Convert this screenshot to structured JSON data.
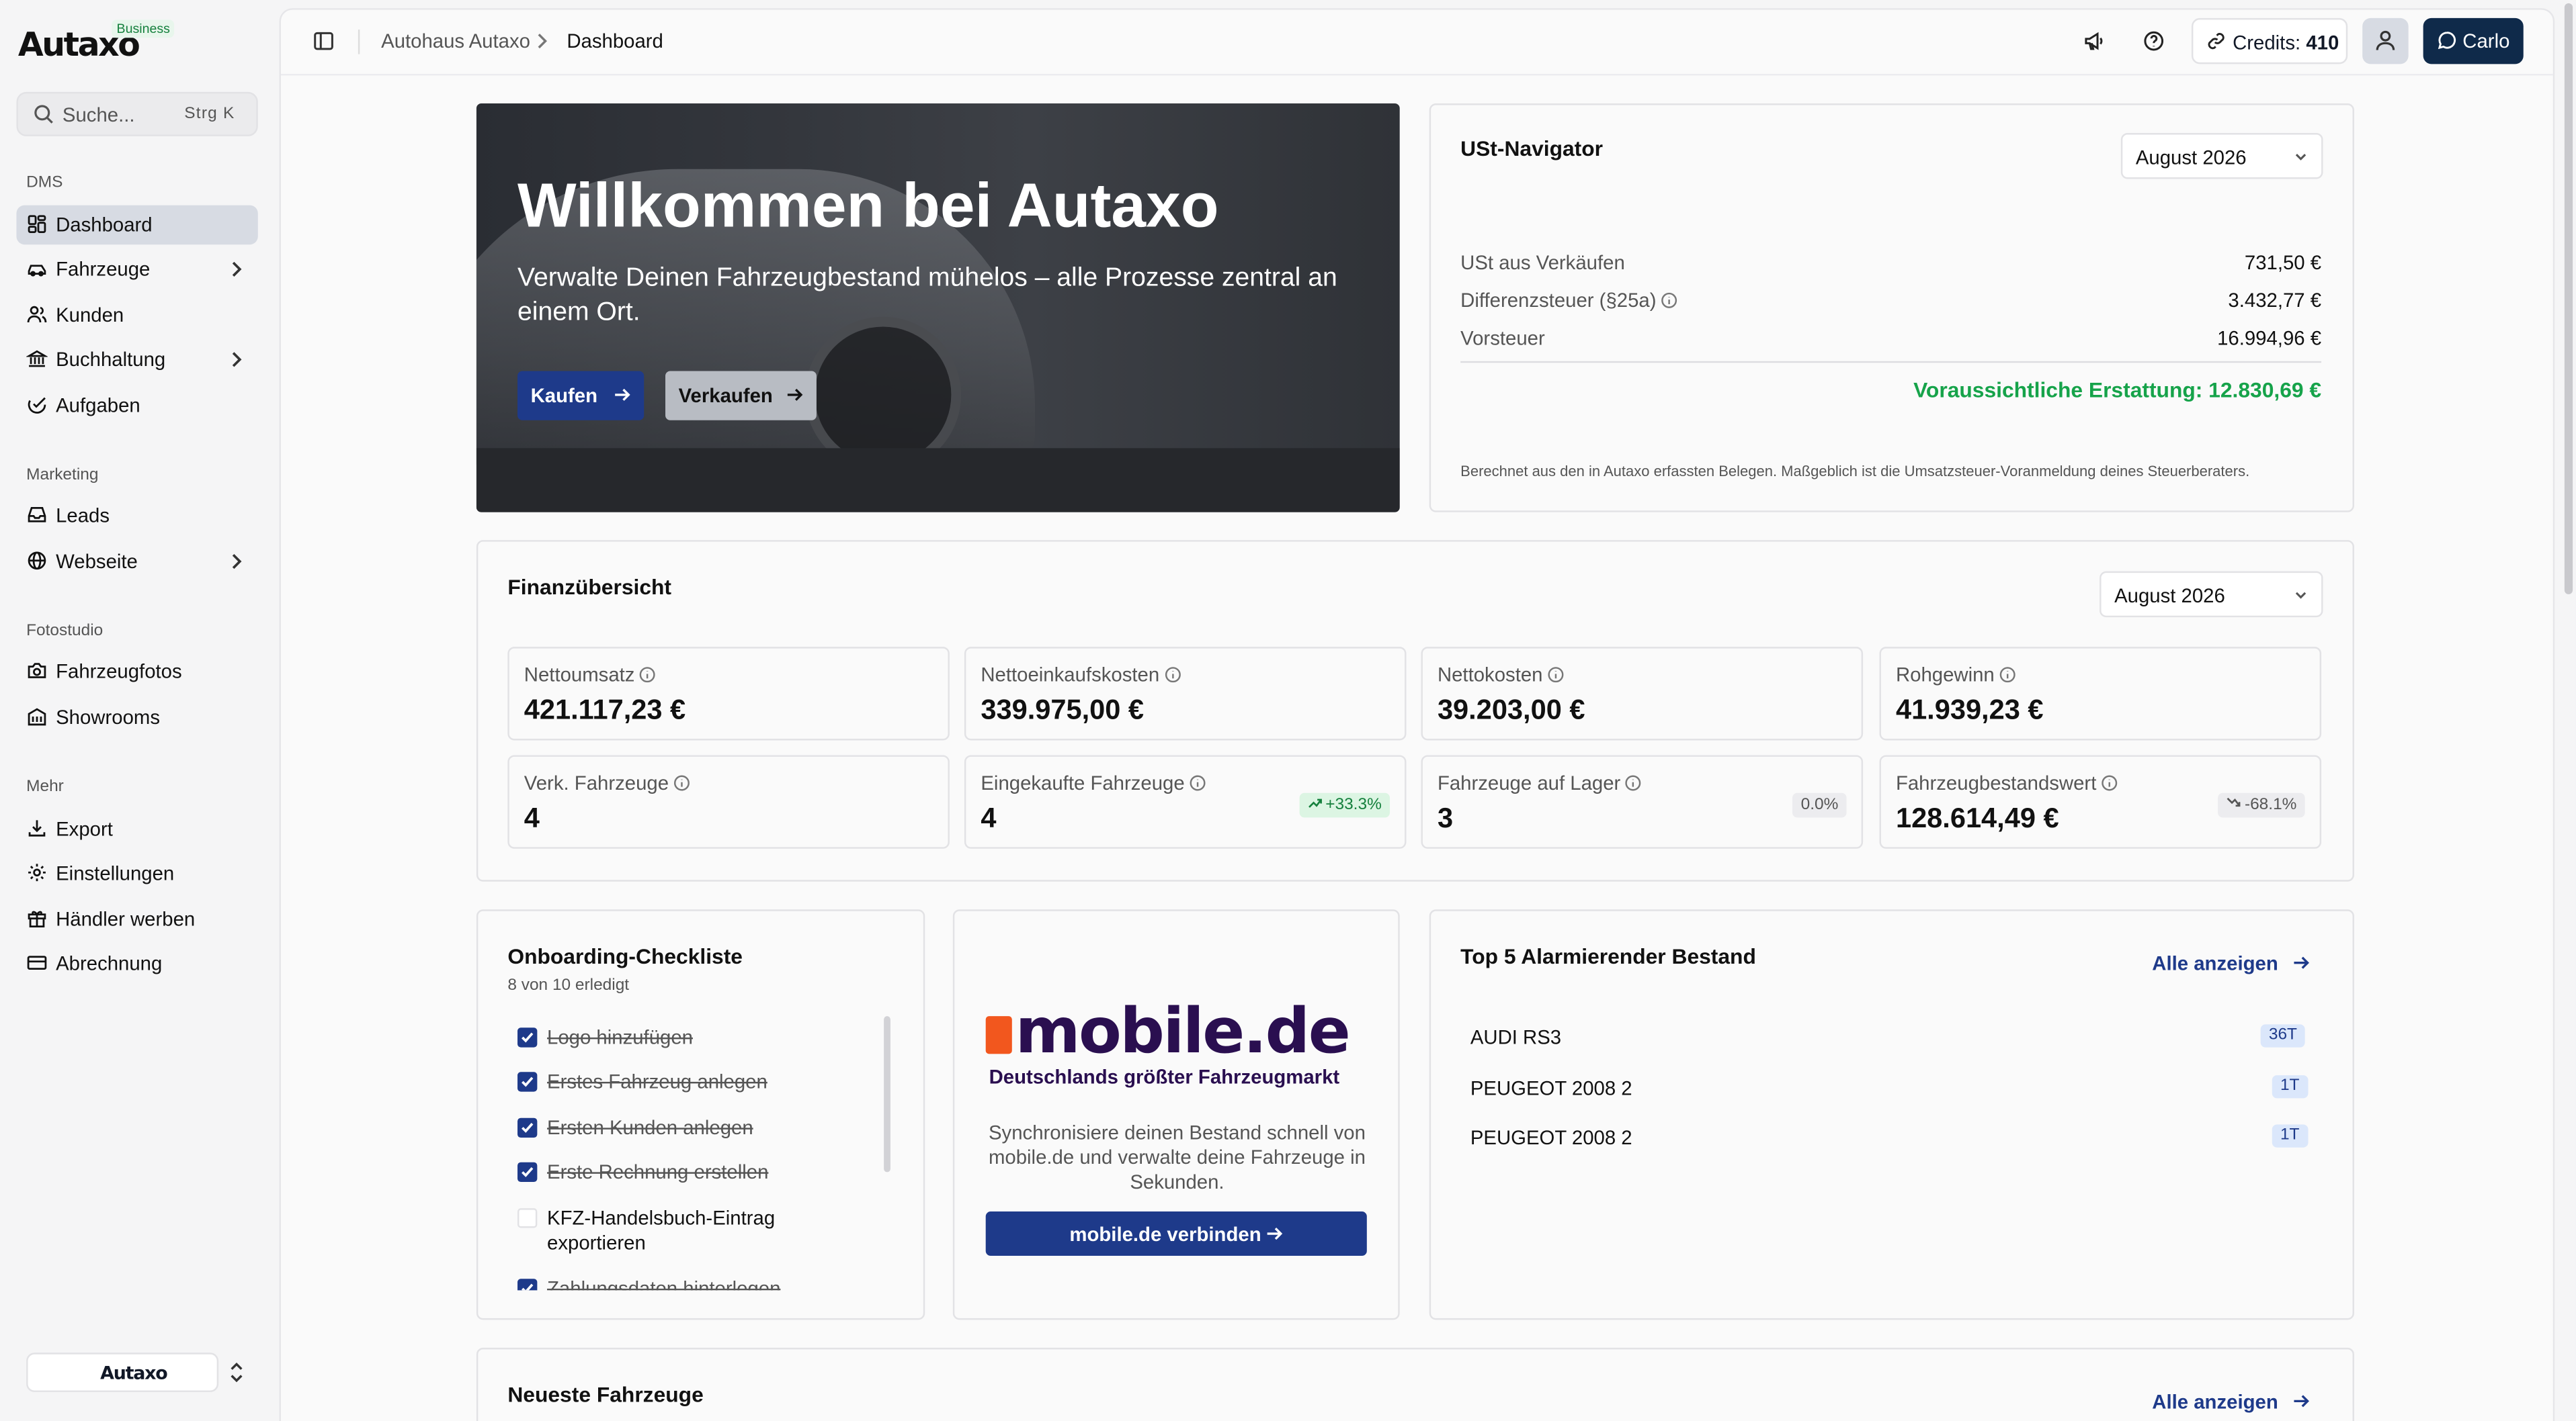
{
  "brand": {
    "logo_text": "Autaxo",
    "badge": "Business",
    "workspace_logo": "Autaxo"
  },
  "search": {
    "placeholder": "Suche...",
    "shortcut": "Strg  K"
  },
  "sidebar": {
    "sections": [
      {
        "label": "DMS",
        "items": [
          {
            "label": "Dashboard",
            "icon": "dashboard-icon",
            "active": true
          },
          {
            "label": "Fahrzeuge",
            "icon": "car-icon",
            "chevron": true
          },
          {
            "label": "Kunden",
            "icon": "users-icon"
          },
          {
            "label": "Buchhaltung",
            "icon": "bank-icon",
            "chevron": true
          },
          {
            "label": "Aufgaben",
            "icon": "check-circle-icon"
          }
        ]
      },
      {
        "label": "Marketing",
        "items": [
          {
            "label": "Leads",
            "icon": "inbox-icon"
          },
          {
            "label": "Webseite",
            "icon": "globe-icon",
            "chevron": true
          }
        ]
      },
      {
        "label": "Fotostudio",
        "items": [
          {
            "label": "Fahrzeugfotos",
            "icon": "camera-icon"
          },
          {
            "label": "Showrooms",
            "icon": "building-icon"
          }
        ]
      },
      {
        "label": "Mehr",
        "items": [
          {
            "label": "Export",
            "icon": "download-icon"
          },
          {
            "label": "Einstellungen",
            "icon": "gear-icon"
          },
          {
            "label": "Händler werben",
            "icon": "gift-icon"
          },
          {
            "label": "Abrechnung",
            "icon": "credit-card-icon"
          }
        ]
      }
    ]
  },
  "topbar": {
    "breadcrumb": [
      "Autohaus Autaxo",
      "Dashboard"
    ],
    "credits_label": "Credits:",
    "credits_value": "410",
    "user_name": "Carlo"
  },
  "hero": {
    "title": "Willkommen bei Autaxo",
    "subtitle": "Verwalte Deinen Fahrzeugbestand mühelos – alle Prozesse zentral an einem Ort.",
    "buy_label": "Kaufen",
    "sell_label": "Verkaufen"
  },
  "vat": {
    "title": "USt-Navigator",
    "period": "August 2026",
    "rows": [
      {
        "label": "USt aus Verkäufen",
        "value": "731,50 €"
      },
      {
        "label": "Differenzsteuer (§25a)",
        "value": "3.432,77 €"
      },
      {
        "label": "Vorsteuer",
        "value": "16.994,96 €"
      }
    ],
    "refund": "Voraussichtliche Erstattung: 12.830,69 €",
    "note": "Berechnet aus den in Autaxo erfassten Belegen. Maßgeblich ist die Umsatzsteuer-Voranmeldung deines Steuerberaters.",
    "refund_color": "#16a34a"
  },
  "finance": {
    "title": "Finanzübersicht",
    "period": "August 2026",
    "kpis": [
      {
        "label": "Nettoumsatz",
        "value": "421.117,23 €"
      },
      {
        "label": "Nettoeinkaufskosten",
        "value": "339.975,00 €"
      },
      {
        "label": "Nettokosten",
        "value": "39.203,00 €"
      },
      {
        "label": "Rohgewinn",
        "value": "41.939,23 €"
      },
      {
        "label": "Verk. Fahrzeuge",
        "value": "4"
      },
      {
        "label": "Eingekaufte Fahrzeuge",
        "value": "4",
        "badge": "+33.3%",
        "trend": "up"
      },
      {
        "label": "Fahrzeuge auf Lager",
        "value": "3",
        "badge": "0.0%",
        "trend": "flat"
      },
      {
        "label": "Fahrzeugbestandswert",
        "value": "128.614,49 €",
        "badge": "-68.1%",
        "trend": "down"
      }
    ]
  },
  "onboarding": {
    "title": "Onboarding-Checkliste",
    "progress": "8 von 10 erledigt",
    "items": [
      {
        "label": "Logo hinzufügen",
        "done": true
      },
      {
        "label": "Erstes Fahrzeug anlegen",
        "done": true
      },
      {
        "label": "Ersten Kunden anlegen",
        "done": true
      },
      {
        "label": "Erste Rechnung erstellen",
        "done": true
      },
      {
        "label": "KFZ-Handelsbuch-Eintrag exportieren",
        "done": false
      },
      {
        "label": "Zahlungsdaten hinterlegen",
        "done": true
      }
    ]
  },
  "mobile": {
    "logo_word": "mobile.de",
    "tagline": "Deutschlands größter Fahrzeugmarkt",
    "description": "Synchronisiere deinen Bestand schnell von mobile.de und verwalte deine Fahrzeuge in Sekunden.",
    "button": "mobile.de verbinden"
  },
  "stock": {
    "title": "Top 5 Alarmierender Bestand",
    "link": "Alle anzeigen",
    "items": [
      {
        "name": "AUDI RS3",
        "badge": "36T"
      },
      {
        "name": "PEUGEOT 2008 2",
        "badge": "1T"
      },
      {
        "name": "PEUGEOT 2008 2",
        "badge": "1T"
      }
    ]
  },
  "newest": {
    "title": "Neueste Fahrzeuge",
    "link": "Alle anzeigen"
  },
  "colors": {
    "primary": "#1e3a8a",
    "navy": "#0f2a4a",
    "success": "#16a34a"
  }
}
